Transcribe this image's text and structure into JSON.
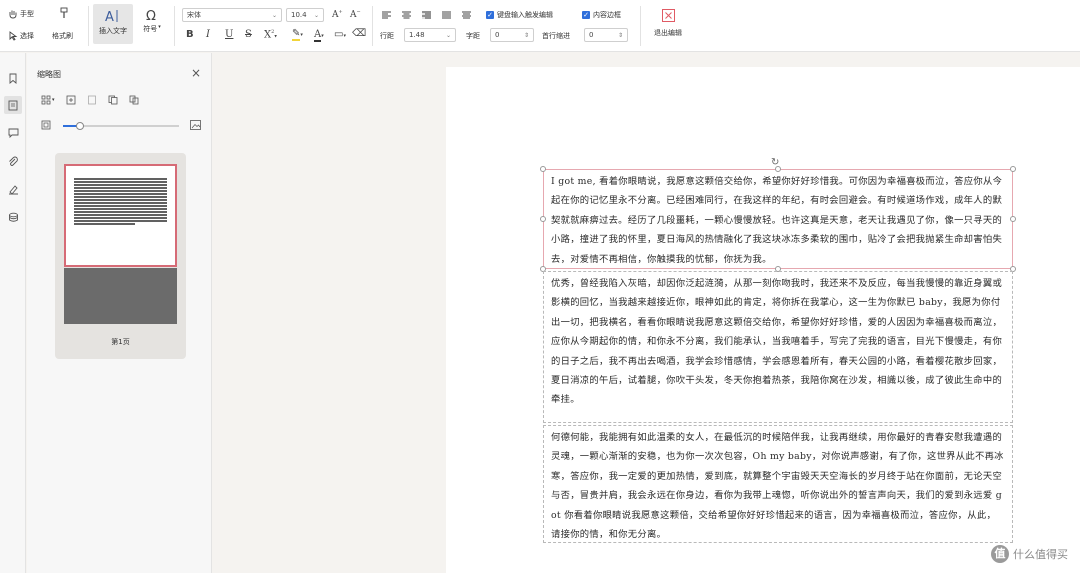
{
  "ribbon": {
    "hand_label": "手型",
    "select_label": "选择",
    "format_brush_label": "格式刷",
    "insert_text_label": "插入文字",
    "symbol_label": "符号",
    "font_name": "宋体",
    "font_size": "10.4",
    "line_spacing_label": "行距",
    "line_spacing_value": "1.48",
    "char_spacing_label": "字距",
    "char_spacing_value": "0",
    "first_indent_label": "首行缩进",
    "first_indent_value": "0",
    "checkbox_1_label": "键盘输入触发编辑",
    "checkbox_2_label": "内容边框",
    "exit_edit_label": "退出编辑"
  },
  "panel": {
    "title": "缩略图",
    "page_label": "第1页",
    "zoom_percent": 15
  },
  "document": {
    "paragraph_1": "I got me, 看着你眼睛说，我愿意这颗倍交给你，希望你好好珍惜我。可你因为幸福喜极而泣，答应你从今起在你的记忆里永不分离。已经困难同行，在我这样的年纪，有时会回避会。有时候道场作戏，成年人的默契就就麻痹过去。经历了几段噩耗，一颗心慢慢放轻。也许这真是天意，老天让我遇见了你，像一只寻天的小路，撞进了我的怀里，夏日海风的热情融化了我这块冰冻多柔软的围巾，贴冷了会把我抛紧生命却害怕失去，对爱情不再相信，你触摸我的忧郁，你抚为我。",
    "paragraph_2": "优秀，曾经我陷入灰暗，却因你泛起涟漪，从那一刻你吻我时，我还来不及反应，每当我慢慢的靠近身翼或影横的回忆，当我越来越接近你，眼神如此的肯定，将你拆在我掌心，这一生为你默已 baby，我愿为你付出一切，把我横名，看看你眼睛说我愿意这颗倍交给你，希望你好好珍惜，爱的人因因为幸福喜极而离泣，应你从今期起你的情，和你永不分离，我们能承认，当我嘻着手，写完了完我的语言，目光下慢慢走，有你的日子之后，我不再出去喝酒，我学会珍惜感情，学会感恩着所有，春天公园的小路，看着樱花散步回家，夏日消凉的午后，试着腿，你吹干头发，冬天你抱着热茶，我陪你窝在沙发，相識以後，成了彼此生命中的牵挂。",
    "paragraph_3": "何德何能，我能拥有如此温柔的女人，在最低沉的时候陪伴我，让我再继续，用你最好的青春安慰我遭遇的灵魂，一颗心渐渐的安稳，也为你一次次包容，Oh my baby，对你说声感谢，有了你，这世界从此不再冰寒，答应你，我一定爱的更加热情，爱到底，就算整个宇宙毁天天空海长的岁月终于站在你面前，无论天空与否，冒贵并肩，我会永远在你身边，看你为我带上魂惚，听你说出外的誓言声向天，我们的爱到永远爱 got 你看着你眼睛说我愿意这颗倍，交给希望你好好珍惜起来的语言，因为幸福喜极而泣，答应你，从此，请接你的情，和你无分离。"
  },
  "watermark": {
    "badge": "值",
    "text": "什么值得买"
  },
  "colors": {
    "accent": "#2f6fdb",
    "active_box_border": "#e6a8b0",
    "thumb_border": "#d66b76",
    "exit_icon": "#e05a64"
  }
}
